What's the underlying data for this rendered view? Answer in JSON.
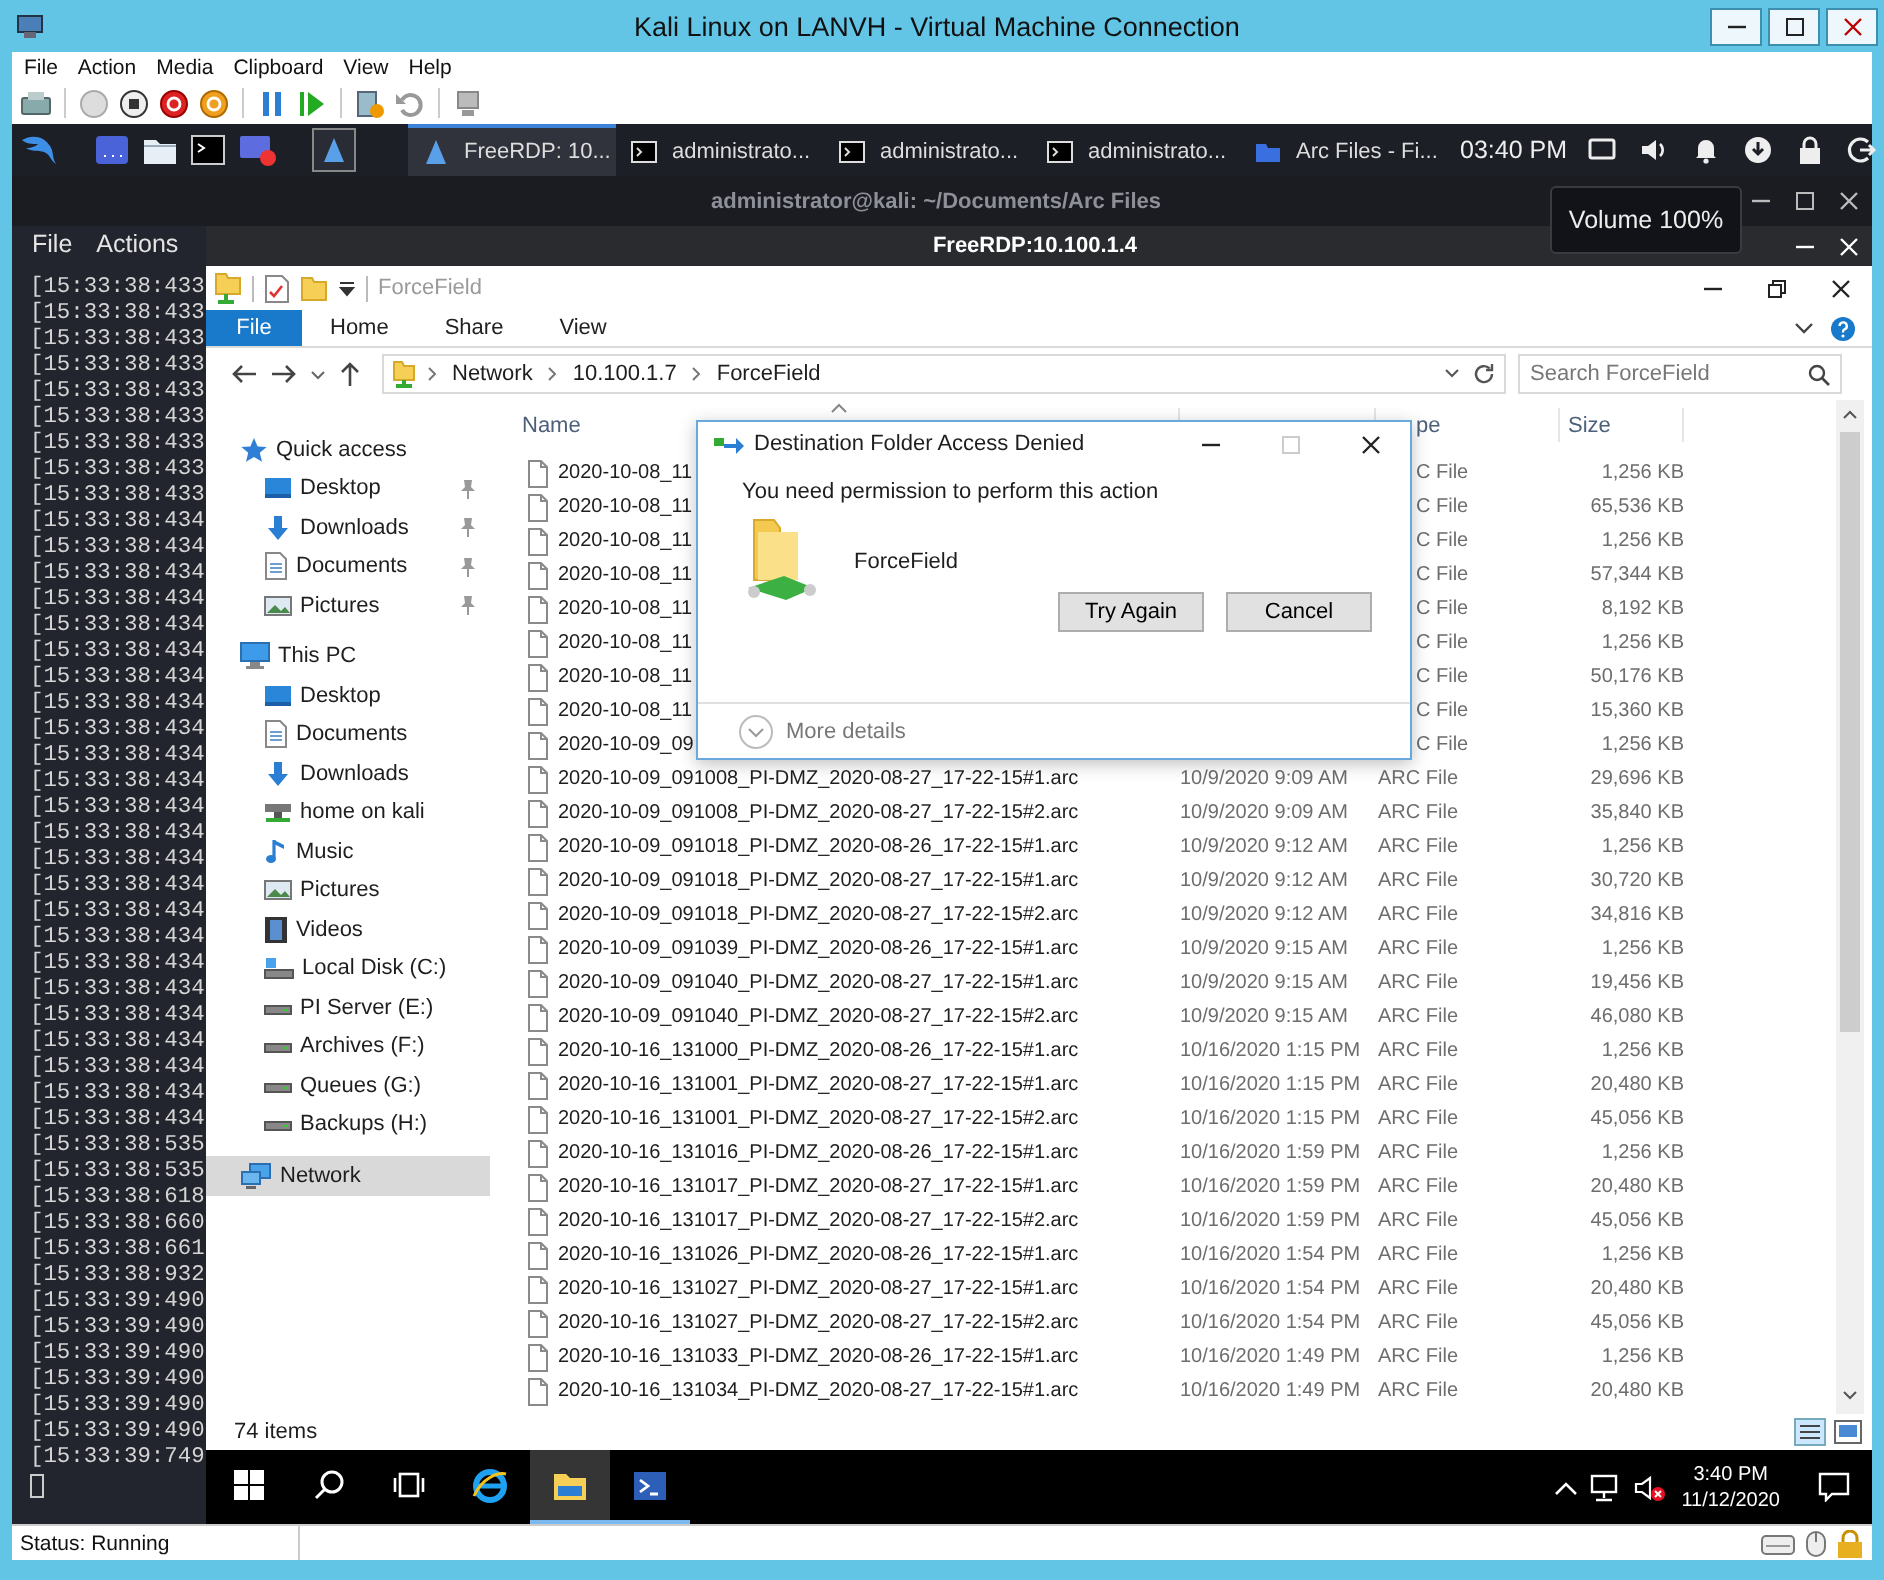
{
  "window": {
    "title": "Kali Linux on LANVH - Virtual Machine Connection",
    "menu": [
      "File",
      "Action",
      "Media",
      "Clipboard",
      "View",
      "Help"
    ]
  },
  "kali_panel": {
    "tasks": [
      {
        "kind": "remote",
        "label": "FreeRDP: 10...",
        "selected": true
      },
      {
        "kind": "terminal",
        "label": "administrato...",
        "selected": false
      },
      {
        "kind": "terminal",
        "label": "administrato...",
        "selected": false
      },
      {
        "kind": "terminal",
        "label": "administrato...",
        "selected": false
      },
      {
        "kind": "folder",
        "label": "Arc Files - Fi...",
        "selected": false
      }
    ],
    "clock": "03:40 PM"
  },
  "tooltip": "Volume 100%",
  "terminal": {
    "title": "administrator@kali: ~/Documents/Arc Files",
    "menu": [
      "File",
      "Actions"
    ],
    "lines": [
      "[15:33:38:433",
      "[15:33:38:433",
      "[15:33:38:433",
      "[15:33:38:433",
      "[15:33:38:433",
      "[15:33:38:433",
      "[15:33:38:433",
      "[15:33:38:433",
      "[15:33:38:433",
      "[15:33:38:434",
      "[15:33:38:434",
      "[15:33:38:434",
      "[15:33:38:434",
      "[15:33:38:434",
      "[15:33:38:434",
      "[15:33:38:434",
      "[15:33:38:434",
      "[15:33:38:434",
      "[15:33:38:434",
      "[15:33:38:434",
      "[15:33:38:434",
      "[15:33:38:434",
      "[15:33:38:434",
      "[15:33:38:434",
      "[15:33:38:434",
      "[15:33:38:434",
      "[15:33:38:434",
      "[15:33:38:434",
      "[15:33:38:434",
      "[15:33:38:434",
      "[15:33:38:434",
      "[15:33:38:434",
      "[15:33:38:434",
      "[15:33:38:535",
      "[15:33:38:535",
      "[15:33:38:618",
      "[15:33:38:660",
      "[15:33:38:661",
      "[15:33:38:932",
      "[15:33:39:490",
      "[15:33:39:490",
      "[15:33:39:490",
      "[15:33:39:490",
      "[15:33:39:490",
      "[15:33:39:490",
      "[15:33:39:749"
    ]
  },
  "remote_window": {
    "title": "FreeRDP:10.100.1.4"
  },
  "explorer": {
    "title": "ForceField",
    "ribbon_tabs": [
      {
        "label": "File",
        "kind": "menu"
      },
      {
        "label": "Home",
        "kind": "tab"
      },
      {
        "label": "Share",
        "kind": "tab"
      },
      {
        "label": "View",
        "kind": "tab"
      }
    ],
    "breadcrumb": [
      "Network",
      "10.100.1.7",
      "ForceField"
    ],
    "search": {
      "placeholder": "Search ForceField"
    },
    "nav": [
      {
        "label": "Quick access",
        "kind": "star",
        "selected": false,
        "children": [
          {
            "label": "Desktop",
            "kind": "desktop",
            "pinned": true,
            "selected": false
          },
          {
            "label": "Downloads",
            "kind": "download",
            "pinned": true,
            "selected": false
          },
          {
            "label": "Documents",
            "kind": "document",
            "pinned": true,
            "selected": false
          },
          {
            "label": "Pictures",
            "kind": "picture",
            "pinned": true,
            "selected": false
          }
        ]
      },
      {
        "label": "This PC",
        "kind": "computer",
        "selected": false,
        "children": [
          {
            "label": "Desktop",
            "kind": "desktop",
            "pinned": false,
            "selected": false
          },
          {
            "label": "Documents",
            "kind": "document",
            "pinned": false,
            "selected": false
          },
          {
            "label": "Downloads",
            "kind": "download",
            "pinned": false,
            "selected": false
          },
          {
            "label": "home on kali",
            "kind": "network-drive",
            "pinned": false,
            "selected": false
          },
          {
            "label": "Music",
            "kind": "music",
            "pinned": false,
            "selected": false
          },
          {
            "label": "Pictures",
            "kind": "picture",
            "pinned": false,
            "selected": false
          },
          {
            "label": "Videos",
            "kind": "video",
            "pinned": false,
            "selected": false
          },
          {
            "label": "Local Disk (C:)",
            "kind": "disk",
            "pinned": false,
            "selected": false
          },
          {
            "label": "PI Server (E:)",
            "kind": "drive",
            "pinned": false,
            "selected": false
          },
          {
            "label": "Archives (F:)",
            "kind": "drive",
            "pinned": false,
            "selected": false
          },
          {
            "label": "Queues (G:)",
            "kind": "drive",
            "pinned": false,
            "selected": false
          },
          {
            "label": "Backups (H:)",
            "kind": "drive",
            "pinned": false,
            "selected": false
          }
        ]
      },
      {
        "label": "Network",
        "kind": "network",
        "selected": true
      }
    ],
    "columns": {
      "name": "Name",
      "type": "pe",
      "size": "Size"
    },
    "rows": [
      {
        "name": "2020-10-08_11",
        "type": "C File",
        "size": "1,256 KB"
      },
      {
        "name": "2020-10-08_11",
        "type": "C File",
        "size": "65,536 KB"
      },
      {
        "name": "2020-10-08_11",
        "type": "C File",
        "size": "1,256 KB"
      },
      {
        "name": "2020-10-08_11",
        "type": "C File",
        "size": "57,344 KB"
      },
      {
        "name": "2020-10-08_11",
        "type": "C File",
        "size": "8,192 KB"
      },
      {
        "name": "2020-10-08_11",
        "type": "C File",
        "size": "1,256 KB"
      },
      {
        "name": "2020-10-08_11",
        "type": "C File",
        "size": "50,176 KB"
      },
      {
        "name": "2020-10-08_11",
        "type": "C File",
        "size": "15,360 KB"
      },
      {
        "name": "2020-10-09_09",
        "type": "C File",
        "size": "1,256 KB"
      },
      {
        "name": "2020-10-09_091008_PI-DMZ_2020-08-27_17-22-15#1.arc",
        "date": "10/9/2020 9:09 AM",
        "type": "ARC File",
        "size": "29,696 KB"
      },
      {
        "name": "2020-10-09_091008_PI-DMZ_2020-08-27_17-22-15#2.arc",
        "date": "10/9/2020 9:09 AM",
        "type": "ARC File",
        "size": "35,840 KB"
      },
      {
        "name": "2020-10-09_091018_PI-DMZ_2020-08-26_17-22-15#1.arc",
        "date": "10/9/2020 9:12 AM",
        "type": "ARC File",
        "size": "1,256 KB"
      },
      {
        "name": "2020-10-09_091018_PI-DMZ_2020-08-27_17-22-15#1.arc",
        "date": "10/9/2020 9:12 AM",
        "type": "ARC File",
        "size": "30,720 KB"
      },
      {
        "name": "2020-10-09_091018_PI-DMZ_2020-08-27_17-22-15#2.arc",
        "date": "10/9/2020 9:12 AM",
        "type": "ARC File",
        "size": "34,816 KB"
      },
      {
        "name": "2020-10-09_091039_PI-DMZ_2020-08-26_17-22-15#1.arc",
        "date": "10/9/2020 9:15 AM",
        "type": "ARC File",
        "size": "1,256 KB"
      },
      {
        "name": "2020-10-09_091040_PI-DMZ_2020-08-27_17-22-15#1.arc",
        "date": "10/9/2020 9:15 AM",
        "type": "ARC File",
        "size": "19,456 KB"
      },
      {
        "name": "2020-10-09_091040_PI-DMZ_2020-08-27_17-22-15#2.arc",
        "date": "10/9/2020 9:15 AM",
        "type": "ARC File",
        "size": "46,080 KB"
      },
      {
        "name": "2020-10-16_131000_PI-DMZ_2020-08-26_17-22-15#1.arc",
        "date": "10/16/2020 1:15 PM",
        "type": "ARC File",
        "size": "1,256 KB"
      },
      {
        "name": "2020-10-16_131001_PI-DMZ_2020-08-27_17-22-15#1.arc",
        "date": "10/16/2020 1:15 PM",
        "type": "ARC File",
        "size": "20,480 KB"
      },
      {
        "name": "2020-10-16_131001_PI-DMZ_2020-08-27_17-22-15#2.arc",
        "date": "10/16/2020 1:15 PM",
        "type": "ARC File",
        "size": "45,056 KB"
      },
      {
        "name": "2020-10-16_131016_PI-DMZ_2020-08-26_17-22-15#1.arc",
        "date": "10/16/2020 1:59 PM",
        "type": "ARC File",
        "size": "1,256 KB"
      },
      {
        "name": "2020-10-16_131017_PI-DMZ_2020-08-27_17-22-15#1.arc",
        "date": "10/16/2020 1:59 PM",
        "type": "ARC File",
        "size": "20,480 KB"
      },
      {
        "name": "2020-10-16_131017_PI-DMZ_2020-08-27_17-22-15#2.arc",
        "date": "10/16/2020 1:59 PM",
        "type": "ARC File",
        "size": "45,056 KB"
      },
      {
        "name": "2020-10-16_131026_PI-DMZ_2020-08-26_17-22-15#1.arc",
        "date": "10/16/2020 1:54 PM",
        "type": "ARC File",
        "size": "1,256 KB"
      },
      {
        "name": "2020-10-16_131027_PI-DMZ_2020-08-27_17-22-15#1.arc",
        "date": "10/16/2020 1:54 PM",
        "type": "ARC File",
        "size": "20,480 KB"
      },
      {
        "name": "2020-10-16_131027_PI-DMZ_2020-08-27_17-22-15#2.arc",
        "date": "10/16/2020 1:54 PM",
        "type": "ARC File",
        "size": "45,056 KB"
      },
      {
        "name": "2020-10-16_131033_PI-DMZ_2020-08-26_17-22-15#1.arc",
        "date": "10/16/2020 1:49 PM",
        "type": "ARC File",
        "size": "1,256 KB"
      },
      {
        "name": "2020-10-16_131034_PI-DMZ_2020-08-27_17-22-15#1.arc",
        "date": "10/16/2020 1:49 PM",
        "type": "ARC File",
        "size": "20,480 KB"
      }
    ],
    "status": "74 items"
  },
  "dialog": {
    "title": "Destination Folder Access Denied",
    "message": "You need permission to perform this action",
    "item": "ForceField",
    "buttons": [
      "Try Again",
      "Cancel"
    ],
    "details": "More details"
  },
  "taskbar": {
    "apps": [
      {
        "kind": "start",
        "selected": false,
        "running": false
      },
      {
        "kind": "search",
        "selected": false,
        "running": false
      },
      {
        "kind": "task-view",
        "selected": false,
        "running": false
      },
      {
        "kind": "browser",
        "selected": false,
        "running": false
      },
      {
        "kind": "file-explorer",
        "selected": true,
        "running": true
      },
      {
        "kind": "terminal",
        "selected": false,
        "running": true
      }
    ],
    "time": "3:40 PM",
    "date": "11/12/2020"
  },
  "status_bar": {
    "text": "Status: Running"
  }
}
